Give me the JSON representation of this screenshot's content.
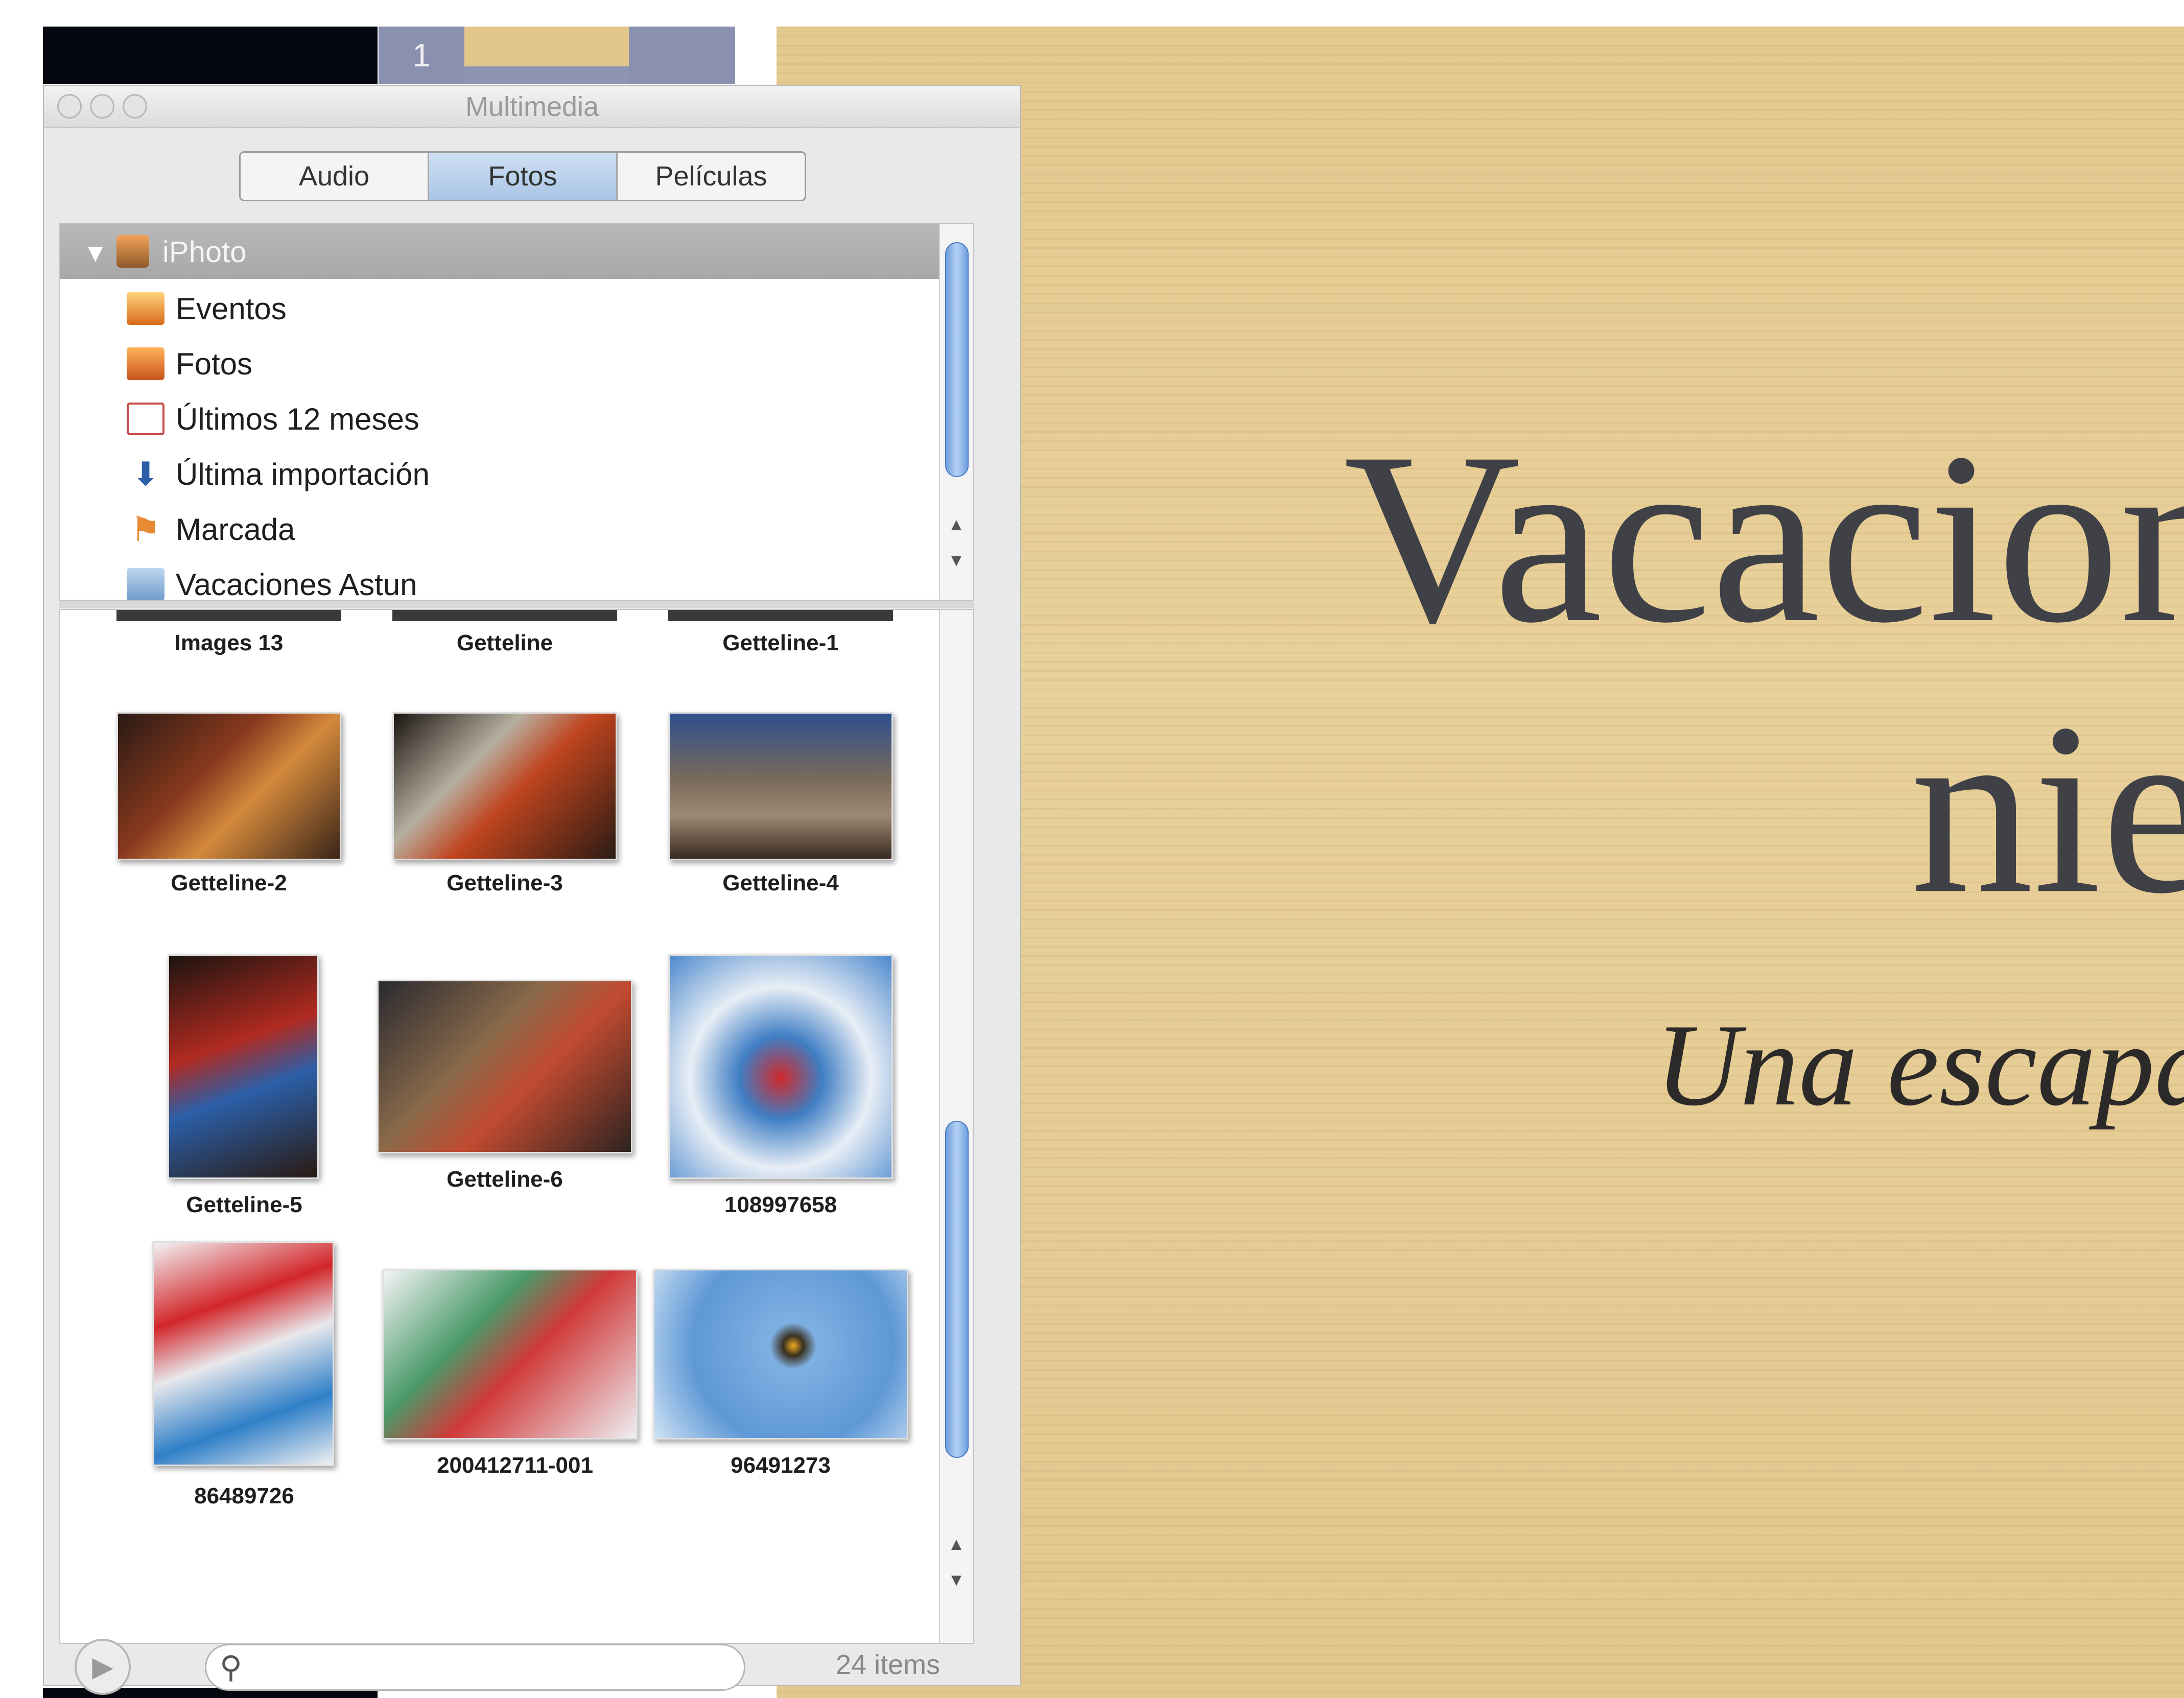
{
  "window": {
    "title": "Multimedia",
    "tabs": [
      "Audio",
      "Fotos",
      "Películas"
    ],
    "active_tab": "Fotos"
  },
  "topbar": {
    "tab_label": "1"
  },
  "source_list": {
    "library": "iPhoto",
    "items": [
      {
        "label": "Eventos",
        "icon": "events-icon"
      },
      {
        "label": "Fotos",
        "icon": "photos-icon"
      },
      {
        "label": "Últimos 12 meses",
        "icon": "calendar-icon"
      },
      {
        "label": "Última importación",
        "icon": "import-icon"
      },
      {
        "label": "Marcada",
        "icon": "flag-icon"
      },
      {
        "label": "Vacaciones Astun",
        "icon": "album-icon"
      }
    ]
  },
  "photos": {
    "partial_row": [
      "Images 13",
      "Getteline",
      "Getteline-1"
    ],
    "rows": [
      [
        "Getteline-2",
        "Getteline-3",
        "Getteline-4"
      ],
      [
        "Getteline-5",
        "Getteline-6",
        "108997658"
      ],
      [
        "86489726",
        "200412711-001",
        "96491273"
      ]
    ]
  },
  "footer": {
    "search_placeholder": "",
    "item_count": "24 items"
  },
  "slide": {
    "title_line1": "Vacacion",
    "title_line2": "nie",
    "subtitle": "Una escapa"
  },
  "colors": {
    "slide_bg": "#e3c98f",
    "title_text": "#3f4146",
    "selection_blue": "#a9c6e6"
  }
}
